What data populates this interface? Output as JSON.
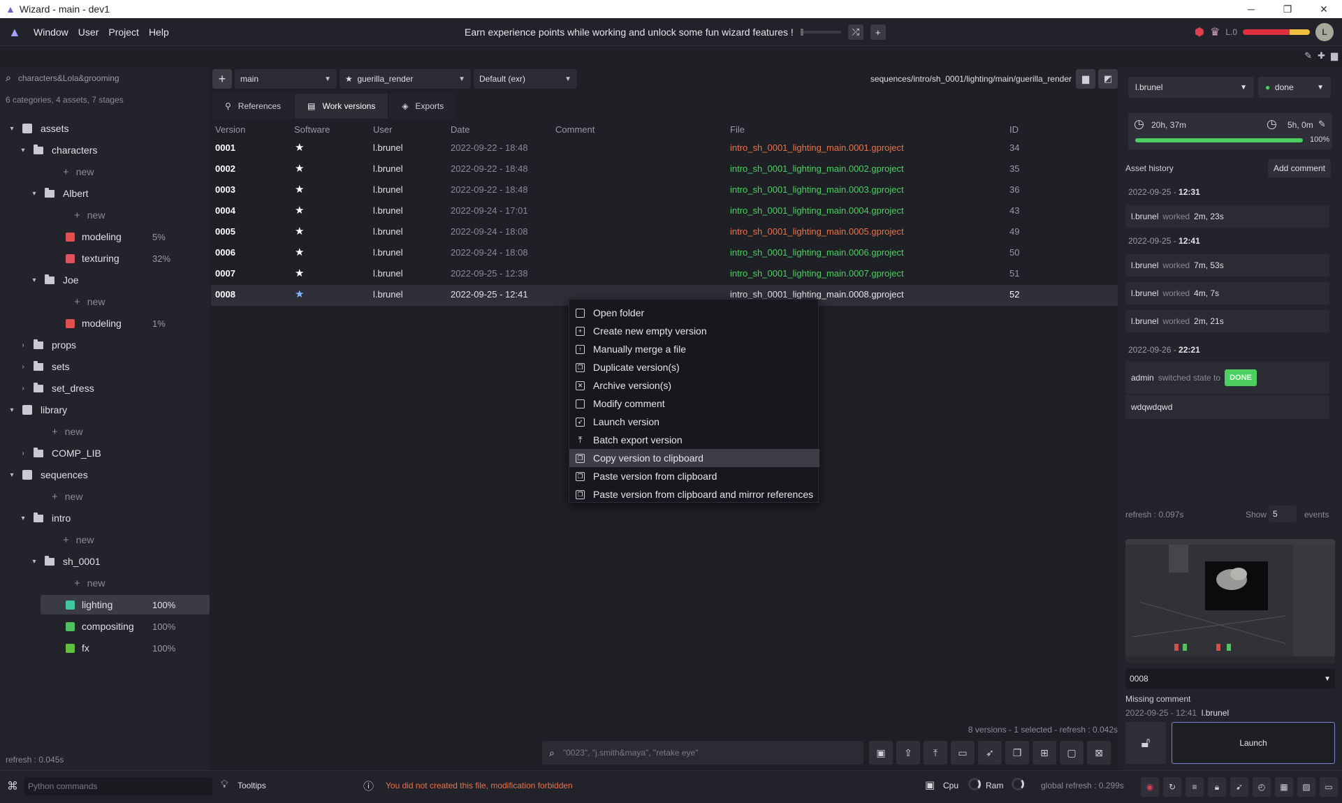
{
  "window": {
    "title": "Wizard - main - dev1",
    "min": "─",
    "max": "❐",
    "close": "✕"
  },
  "menu": {
    "items": [
      "Window",
      "User",
      "Project",
      "Help"
    ],
    "xp_text": "Earn experience points while working and unlock some fun wizard features !",
    "level": "L.0",
    "avatar": "L"
  },
  "sidebar": {
    "search": "characters&Lola&grooming",
    "summary": "6 categories, 4 assets, 7 stages",
    "refresh": "refresh : 0.045s",
    "tree": [
      {
        "label": "assets",
        "kind": "root",
        "chev": "▾"
      },
      {
        "label": "characters",
        "kind": "folder",
        "chev": "▾"
      },
      {
        "label": "new",
        "kind": "new"
      },
      {
        "label": "Albert",
        "kind": "folder",
        "chev": "▾"
      },
      {
        "label": "new",
        "kind": "new"
      },
      {
        "label": "modeling",
        "kind": "stage",
        "pct": "5%",
        "color": "#e05050"
      },
      {
        "label": "texturing",
        "kind": "stage",
        "pct": "32%",
        "color": "#e05060"
      },
      {
        "label": "Joe",
        "kind": "folder",
        "chev": "▾"
      },
      {
        "label": "new",
        "kind": "new"
      },
      {
        "label": "modeling",
        "kind": "stage",
        "pct": "1%",
        "color": "#e05050"
      },
      {
        "label": "props",
        "kind": "folder",
        "chev": "›"
      },
      {
        "label": "sets",
        "kind": "folder",
        "chev": "›"
      },
      {
        "label": "set_dress",
        "kind": "folder",
        "chev": "›"
      },
      {
        "label": "library",
        "kind": "root",
        "chev": "▾"
      },
      {
        "label": "new",
        "kind": "new"
      },
      {
        "label": "COMP_LIB",
        "kind": "folder",
        "chev": "›"
      },
      {
        "label": "sequences",
        "kind": "root",
        "chev": "▾"
      },
      {
        "label": "new",
        "kind": "new"
      },
      {
        "label": "intro",
        "kind": "folder",
        "chev": "▾"
      },
      {
        "label": "new",
        "kind": "new"
      },
      {
        "label": "sh_0001",
        "kind": "folder",
        "chev": "▾"
      },
      {
        "label": "new",
        "kind": "new"
      },
      {
        "label": "lighting",
        "kind": "stage",
        "pct": "100%",
        "color": "#40c8a0",
        "selected": true
      },
      {
        "label": "compositing",
        "kind": "stage",
        "pct": "100%",
        "color": "#50c060"
      },
      {
        "label": "fx",
        "kind": "stage",
        "pct": "100%",
        "color": "#60c040"
      }
    ]
  },
  "toolbar": {
    "variant": "main",
    "software": "guerilla_render",
    "export_format": "Default (exr)",
    "path": "sequences/intro/sh_0001/lighting/main/guerilla_render"
  },
  "tabs": [
    "References",
    "Work versions",
    "Exports"
  ],
  "table": {
    "headers": [
      "Version",
      "Software",
      "User",
      "Date",
      "Comment",
      "File",
      "ID"
    ],
    "rows": [
      {
        "version": "0001",
        "software": "★",
        "user": "l.brunel",
        "date": "2022-09-22 - 18:48",
        "comment": "",
        "file": "intro_sh_0001_lighting_main.0001.gproject",
        "id": "34",
        "file_color": "#e8734a"
      },
      {
        "version": "0002",
        "software": "★",
        "user": "l.brunel",
        "date": "2022-09-22 - 18:48",
        "comment": "",
        "file": "intro_sh_0001_lighting_main.0002.gproject",
        "id": "35",
        "file_color": "#4ccf60"
      },
      {
        "version": "0003",
        "software": "★",
        "user": "l.brunel",
        "date": "2022-09-22 - 18:48",
        "comment": "",
        "file": "intro_sh_0001_lighting_main.0003.gproject",
        "id": "36",
        "file_color": "#4ccf60"
      },
      {
        "version": "0004",
        "software": "★",
        "user": "l.brunel",
        "date": "2022-09-24 - 17:01",
        "comment": "",
        "file": "intro_sh_0001_lighting_main.0004.gproject",
        "id": "43",
        "file_color": "#4ccf60"
      },
      {
        "version": "0005",
        "software": "★",
        "user": "l.brunel",
        "date": "2022-09-24 - 18:08",
        "comment": "",
        "file": "intro_sh_0001_lighting_main.0005.gproject",
        "id": "49",
        "file_color": "#e8734a"
      },
      {
        "version": "0006",
        "software": "★",
        "user": "l.brunel",
        "date": "2022-09-24 - 18:08",
        "comment": "",
        "file": "intro_sh_0001_lighting_main.0006.gproject",
        "id": "50",
        "file_color": "#4ccf60"
      },
      {
        "version": "0007",
        "software": "★",
        "user": "l.brunel",
        "date": "2022-09-25 - 12:38",
        "comment": "",
        "file": "intro_sh_0001_lighting_main.0007.gproject",
        "id": "51",
        "file_color": "#4ccf60"
      },
      {
        "version": "0008",
        "software": "★",
        "user": "l.brunel",
        "date": "2022-09-25 - 12:41",
        "comment": "",
        "file": "intro_sh_0001_lighting_main.0008.gproject",
        "id": "52",
        "file_color": "#e6e6ea",
        "selected": true
      }
    ],
    "status": "8 versions - 1 selected - refresh : 0.042s"
  },
  "context_menu": {
    "items": [
      "Open folder",
      "Create new empty version",
      "Manually merge a file",
      "Duplicate version(s)",
      "Archive version(s)",
      "Modify comment",
      "Launch version",
      "Batch export version",
      "Copy version to clipboard",
      "Paste version from clipboard",
      "Paste version from clipboard and mirror references"
    ],
    "highlighted": 8
  },
  "search": {
    "placeholder": "\"0023\", \"j.smith&maya\", \"retake eye\""
  },
  "right": {
    "user": "l.brunel",
    "state": "done",
    "time_spent": "20h, 37m",
    "estimated": "5h, 0m",
    "progress_pct": 100,
    "progress_label": "100%",
    "history_label": "Asset history",
    "add_comment": "Add comment",
    "history": [
      {
        "type": "date",
        "date": "2022-09-25 - ",
        "time": "12:31"
      },
      {
        "type": "event",
        "user": "l.brunel",
        "action": "worked",
        "value": "2m, 23s"
      },
      {
        "type": "date",
        "date": "2022-09-25 - ",
        "time": "12:41"
      },
      {
        "type": "event",
        "user": "l.brunel",
        "action": "worked",
        "value": "7m, 53s"
      },
      {
        "type": "event",
        "user": "l.brunel",
        "action": "worked",
        "value": "4m, 7s"
      },
      {
        "type": "event",
        "user": "l.brunel",
        "action": "worked",
        "value": "2m, 21s"
      },
      {
        "type": "date",
        "date": "2022-09-26 - ",
        "time": "22:21"
      },
      {
        "type": "state",
        "user": "admin",
        "action": "switched state to",
        "value": "DONE"
      },
      {
        "type": "comment",
        "value": "wdqwdqwd"
      }
    ],
    "refresh": "refresh : 0.097s",
    "show_label": "Show",
    "show_count": "5",
    "events_label": "events",
    "version": "0008",
    "missing_comment": "Missing comment",
    "version_date": "2022-09-25 - 12:41",
    "version_user": "l.brunel",
    "launch": "Launch"
  },
  "statusbar": {
    "python_placeholder": "Python commands",
    "tooltips": "Tooltips",
    "message": "You did not created this file, modification forbidden",
    "cpu": "Cpu",
    "ram": "Ram",
    "global_refresh": "global refresh : 0.299s"
  }
}
